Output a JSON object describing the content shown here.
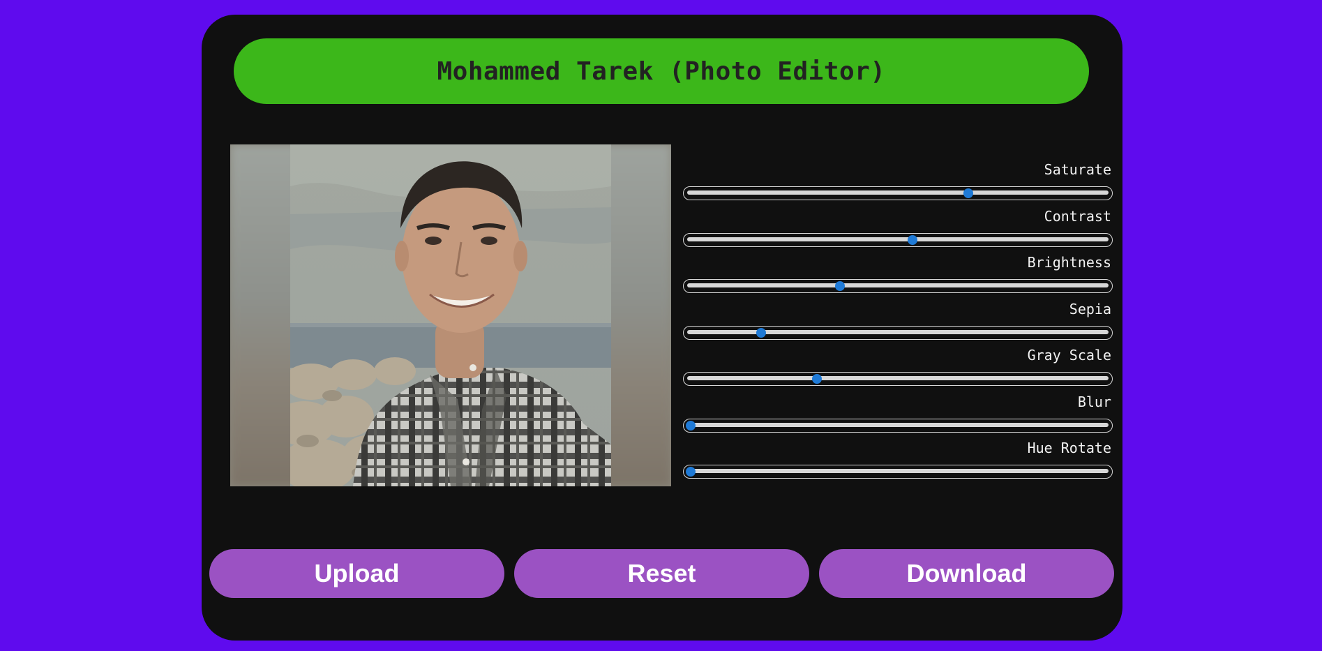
{
  "header": {
    "title": "Mohammed Tarek (Photo Editor)"
  },
  "colors": {
    "page_background": "#5f0bee",
    "card_background": "#101010",
    "title_bar": "#3cb71a",
    "button": "#9b52c3",
    "slider_thumb": "#1f7ad6"
  },
  "controls": [
    {
      "label": "Saturate",
      "fraction": 0.67
    },
    {
      "label": "Contrast",
      "fraction": 0.535
    },
    {
      "label": "Brightness",
      "fraction": 0.36
    },
    {
      "label": "Sepia",
      "fraction": 0.17
    },
    {
      "label": "Gray Scale",
      "fraction": 0.305
    },
    {
      "label": "Blur",
      "fraction": 0.0
    },
    {
      "label": "Hue Rotate",
      "fraction": 0.0
    }
  ],
  "buttons": {
    "upload": "Upload",
    "reset": "Reset",
    "download": "Download"
  }
}
